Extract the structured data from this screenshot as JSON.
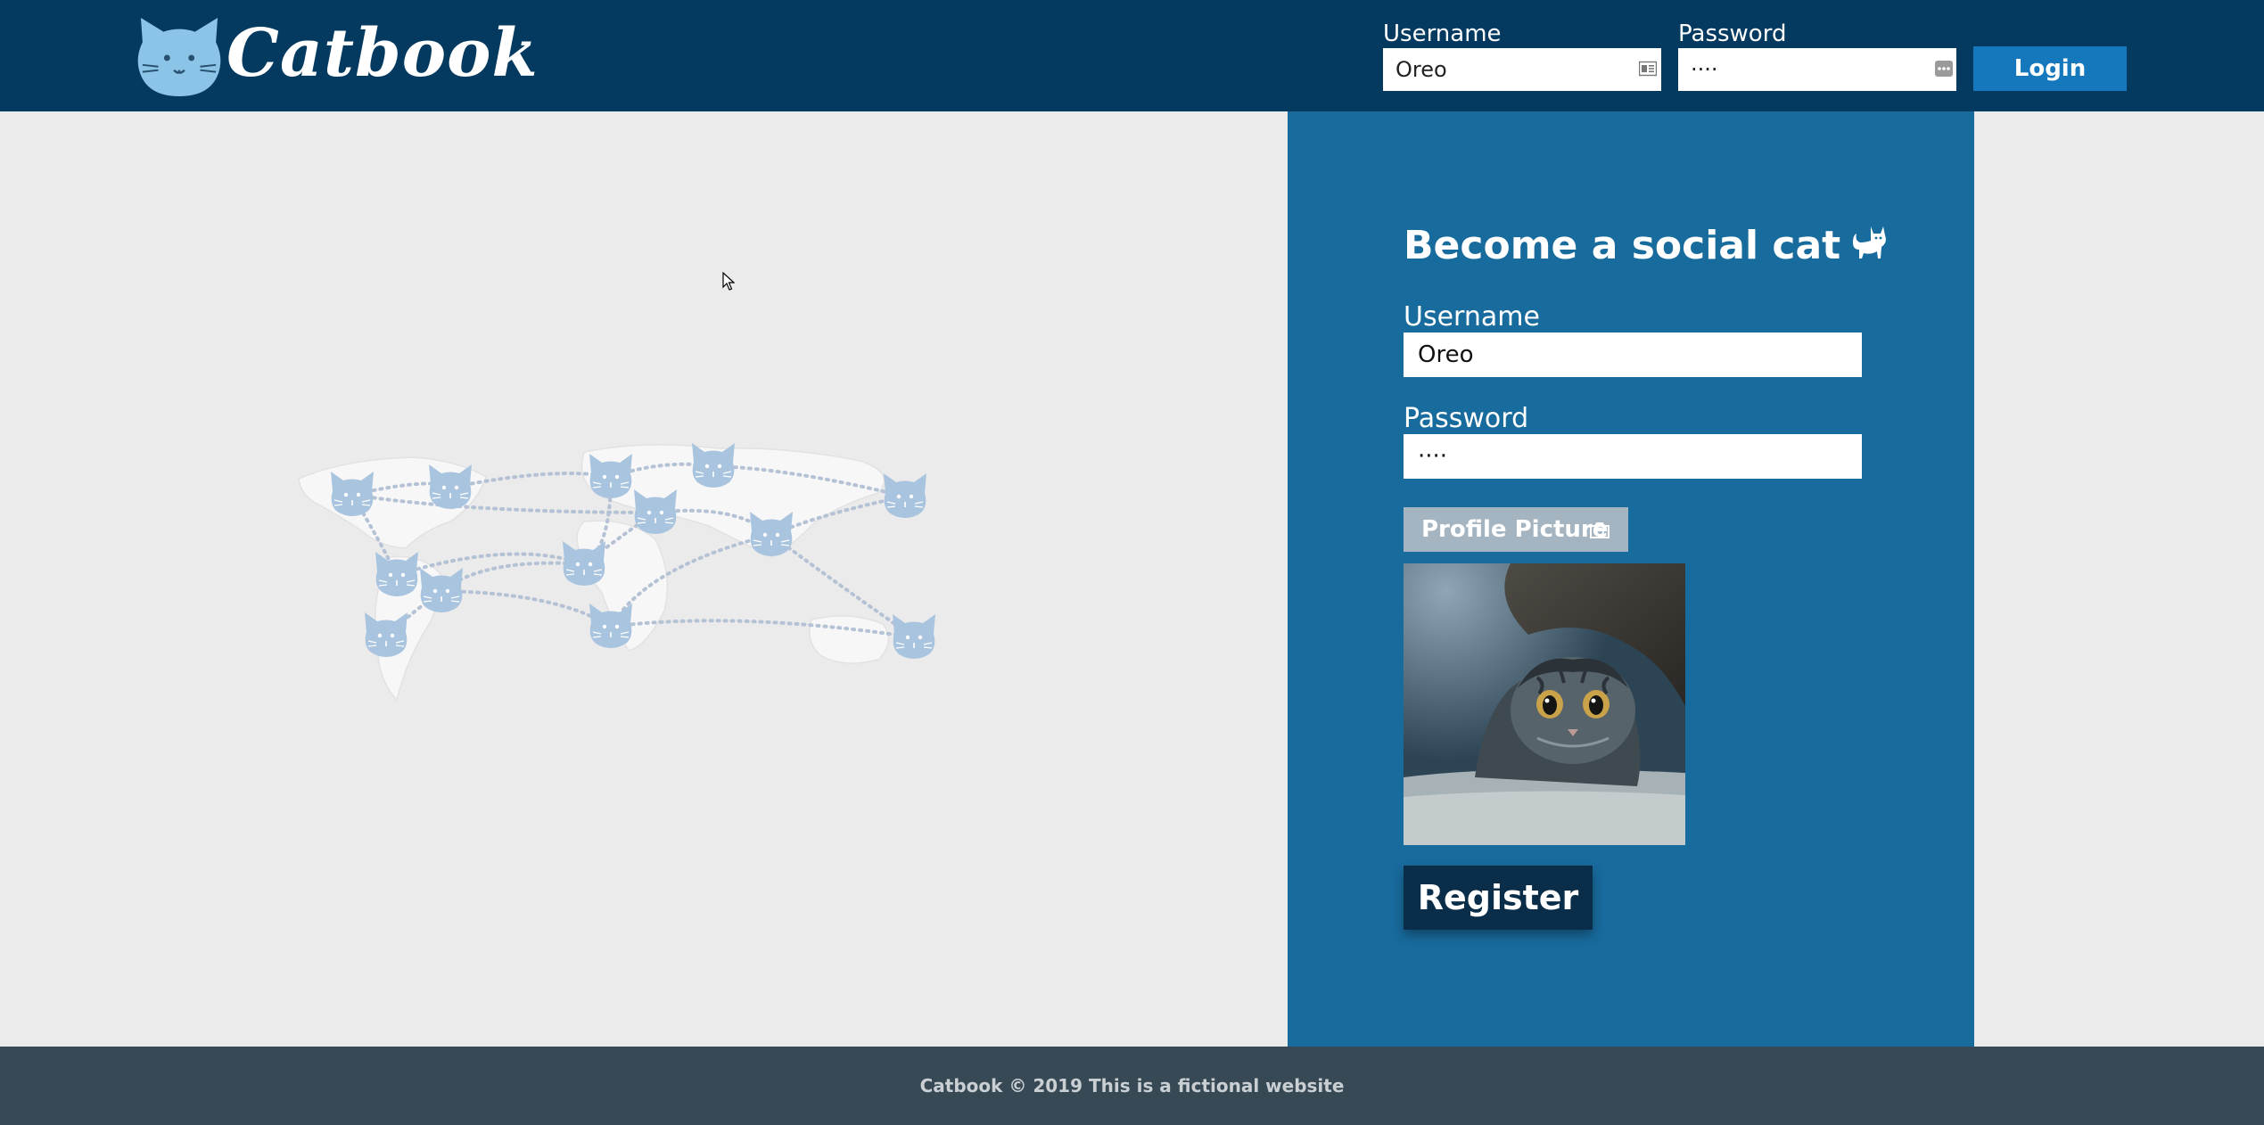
{
  "brand": {
    "name": "Catbook"
  },
  "header_login": {
    "username_label": "Username",
    "username_value": "Oreo",
    "password_label": "Password",
    "password_value": "····",
    "login_label": "Login"
  },
  "register": {
    "title": "Become a social cat",
    "username_label": "Username",
    "username_value": "Oreo",
    "password_label": "Password",
    "password_value": "····",
    "profile_picture_label": "Profile Picture",
    "register_label": "Register"
  },
  "footer": {
    "text": "Catbook © 2019 This is a fictional website"
  },
  "icons": {
    "logo": "cat-face-icon",
    "username_field": "id-card-icon",
    "password_field": "password-dots-icon",
    "title": "cat-silhouette-icon",
    "profile_picture": "camera-icon"
  },
  "colors": {
    "header": "#043a5f",
    "panel": "#186b9d",
    "login_button": "#1578bd",
    "register_button": "#0a2e49",
    "footer": "#374954",
    "page_background": "#ebebeb"
  }
}
